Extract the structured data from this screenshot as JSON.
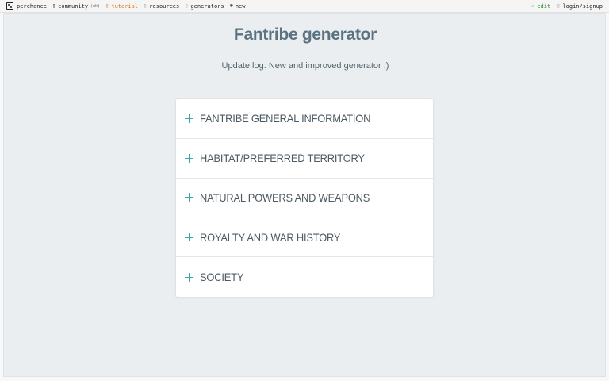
{
  "topbar": {
    "brand": "perchance",
    "community": "community",
    "community_tag": "(wh)",
    "tutorial": "tutorial",
    "resources": "resources",
    "generators": "generators",
    "new": "new",
    "edit": "edit",
    "login": "login/signup",
    "colors": {
      "tutorial": "#d97a1c",
      "edit": "#2e8b2e"
    }
  },
  "page": {
    "title": "Fantribe generator",
    "subtitle": "Update log: New and improved generator :)"
  },
  "accordion": {
    "items": [
      {
        "label": "FANTRIBE GENERAL INFORMATION"
      },
      {
        "label": "HABITAT/PREFERRED TERRITORY"
      },
      {
        "label": "NATURAL POWERS AND WEAPONS"
      },
      {
        "label": "ROYALTY AND WAR HISTORY"
      },
      {
        "label": "SOCIETY"
      }
    ],
    "accent": "#3aa6b0"
  }
}
